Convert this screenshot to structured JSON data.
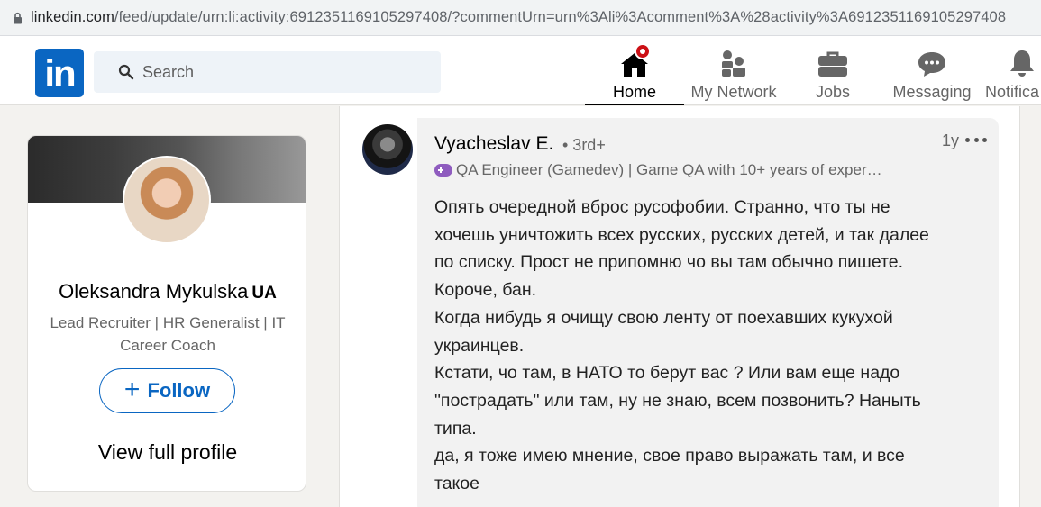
{
  "browser": {
    "url_host": "linkedin.com",
    "url_path": "/feed/update/urn:li:activity:6912351169105297408/?commentUrn=urn%3Ali%3Acomment%3A%28activity%3A6912351169105297408"
  },
  "header": {
    "logo": "in",
    "search_placeholder": "Search",
    "nav": [
      {
        "label": "Home",
        "icon": "home-icon",
        "active": true
      },
      {
        "label": "My Network",
        "icon": "network-icon",
        "active": false
      },
      {
        "label": "Jobs",
        "icon": "briefcase-icon",
        "active": false
      },
      {
        "label": "Messaging",
        "icon": "messaging-icon",
        "active": false
      },
      {
        "label": "Notifica",
        "icon": "bell-icon",
        "active": false
      }
    ]
  },
  "profile": {
    "name": "Oleksandra Mykulska",
    "flag": "UA",
    "headline": "Lead Recruiter | HR Generalist | IT Career Coach",
    "follow_icon": "+",
    "follow_label": "Follow",
    "view_profile_label": "View full profile"
  },
  "comment": {
    "author": "Vyacheslav E.",
    "degree": "• 3rd+",
    "headline": "QA Engineer (Gamedev) | Game QA with 10+ years of exper…",
    "time": "1y",
    "lines": [
      "Опять очередной вброс русофобии. Странно, что ты не",
      "хочешь уничтожить всех русских, русских детей, и так далее",
      "по списку. Прост не припомню чо вы там обычно пишете.",
      "Короче, бан.",
      "Когда нибудь я очищу свою ленту от поехавших кукухой",
      "украинцев.",
      "Кстати, чо там, в НАТО то берут вас ? Или вам еще надо",
      "\"пострадать\" или там, ну не знаю, всем позвонить? Наныть",
      "типа.",
      "да, я тоже имею мнение, свое право выражать там, и все",
      "такое"
    ]
  }
}
